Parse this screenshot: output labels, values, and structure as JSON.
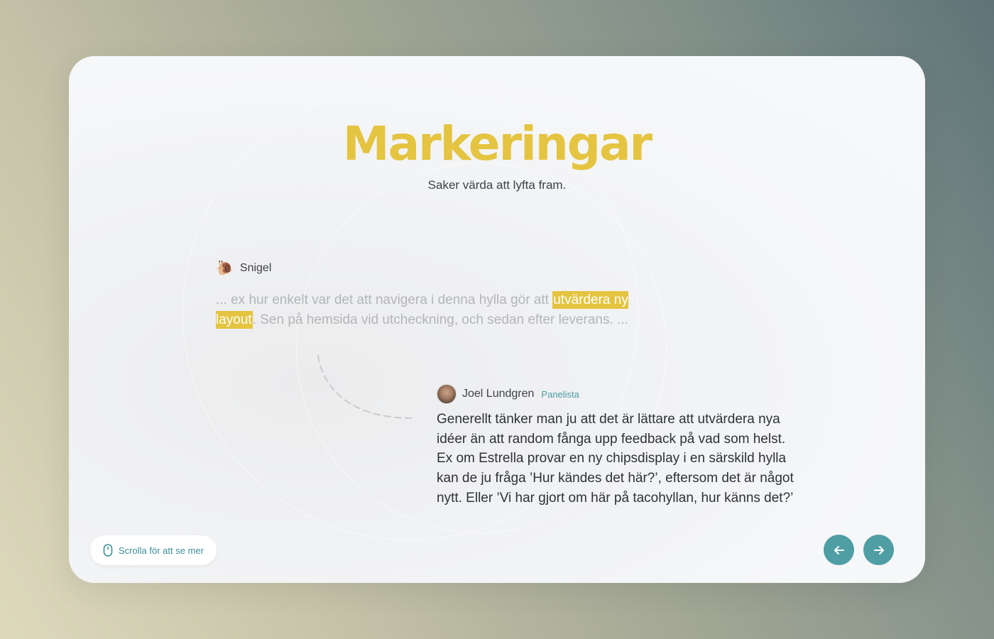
{
  "header": {
    "title": "Markeringar",
    "subtitle": "Saker värda att lyfta fram."
  },
  "quote": {
    "author_emoji": "🐌",
    "author": "Snigel",
    "text_before": "... ex hur enkelt var det att navigera i denna hylla gör att ",
    "highlight": "utvärdera ny layout",
    "text_after": ". Sen på hemsida vid utcheckning, och sedan efter leverans. ..."
  },
  "reply": {
    "name": "Joel Lundgren",
    "role": "Panelista",
    "text": "Generellt tänker man ju att det är lättare att utvärdera nya idéer än att random fånga upp feedback på vad som helst. Ex om Estrella provar en ny chipsdisplay i en särskild hylla kan de ju fråga ’Hur kändes det här?’, eftersom det är något nytt. Eller ’Vi har gjort om här på tacohyllan, hur känns det?’"
  },
  "footer": {
    "scroll_hint": "Scrolla för att se mer",
    "scroll_icon": "mouse-icon",
    "prev_icon": "arrow-left-icon",
    "next_icon": "arrow-right-icon"
  },
  "colors": {
    "accent_yellow": "#e4c440",
    "accent_teal": "#4f9ea4"
  }
}
